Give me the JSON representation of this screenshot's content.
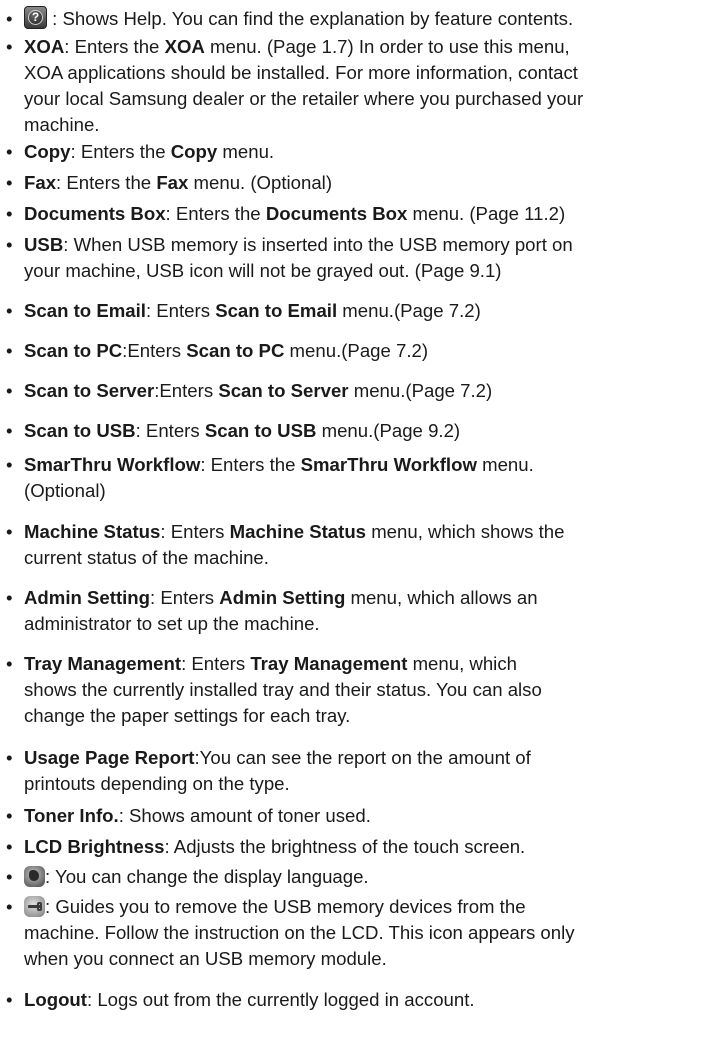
{
  "items": [
    {
      "icon": "help-icon",
      "l1_b": " : Shows Help. You can find the explanation by feature contents."
    },
    {
      "term": "XOA",
      "l1_a": ": Enters the ",
      "l1_bold": "XOA",
      "l1_b": " menu. (Page 1.7) In order to use this menu,",
      "l2": "XOA applications should be installed. For more information, contact",
      "l3": "your local Samsung dealer or the retailer where you purchased your",
      "l4": "machine."
    },
    {
      "term": "Copy",
      "l1_a": ": Enters the ",
      "l1_bold": "Copy",
      "l1_b": " menu."
    },
    {
      "term": "Fax",
      "l1_a": ": Enters the ",
      "l1_bold": "Fax",
      "l1_b": " menu. (Optional)"
    },
    {
      "term": "Documents Box",
      "l1_a": ": Enters the ",
      "l1_bold": "Documents Box",
      "l1_b": " menu. (Page 11.2)"
    },
    {
      "term": "USB",
      "l1_a": ": When USB memory is inserted into the USB memory port on",
      "l2": "your machine, USB icon will not be grayed out. (Page 9.1)"
    },
    {
      "term": "Scan to Email",
      "l1_a": ": Enters ",
      "l1_bold": "Scan to Email",
      "l1_b": " menu.(Page 7.2)"
    },
    {
      "term": "Scan to PC",
      "l1_a": ":Enters ",
      "l1_bold": "Scan to PC",
      "l1_b": " menu.(Page 7.2)"
    },
    {
      "term": "Scan to Server",
      "l1_a": ":Enters ",
      "l1_bold": "Scan to Server",
      "l1_b": " menu.(Page 7.2)"
    },
    {
      "term": "Scan to USB",
      "l1_a": ": Enters ",
      "l1_bold": "Scan to USB",
      "l1_b": " menu.(Page 9.2)"
    },
    {
      "term": "SmarThru Workflow",
      "l1_a": ": Enters the ",
      "l1_bold": "SmarThru Workflow",
      "l1_b": " menu.",
      "l2": "(Optional)"
    },
    {
      "term": "Machine Status",
      "l1_a": ": Enters ",
      "l1_bold": "Machine Status",
      "l1_b": " menu, which shows the",
      "l2": "current status of the machine."
    },
    {
      "term": "Admin Setting",
      "l1_a": ": Enters ",
      "l1_bold": "Admin Setting",
      "l1_b": " menu, which allows an",
      "l2": "administrator to set up the machine."
    },
    {
      "term": "Tray Management",
      "l1_a": ": Enters ",
      "l1_bold": "Tray Management",
      "l1_b": " menu, which",
      "l2": "shows the currently installed tray and their status. You can also",
      "l3": "change the paper settings for each tray."
    },
    {
      "term": "Usage Page Report",
      "l1_a": ":You can see the report on the amount of",
      "l2": "printouts depending on the type."
    },
    {
      "term": "Toner Info.",
      "l1_a": ": Shows amount of toner used."
    },
    {
      "term": "LCD Brightness",
      "l1_a": ": Adjusts the brightness of the touch screen."
    },
    {
      "icon": "language-globe-icon",
      "l1_b": ": You can change the display language."
    },
    {
      "icon": "usb-remove-icon",
      "l1_b": ": Guides you to remove the USB memory devices from the",
      "l2": "machine. Follow the instruction on the LCD. This icon appears only",
      "l3": "when you connect an USB memory module."
    },
    {
      "term": "Logout",
      "l1_a": ": Logs out from the currently logged in account."
    }
  ]
}
